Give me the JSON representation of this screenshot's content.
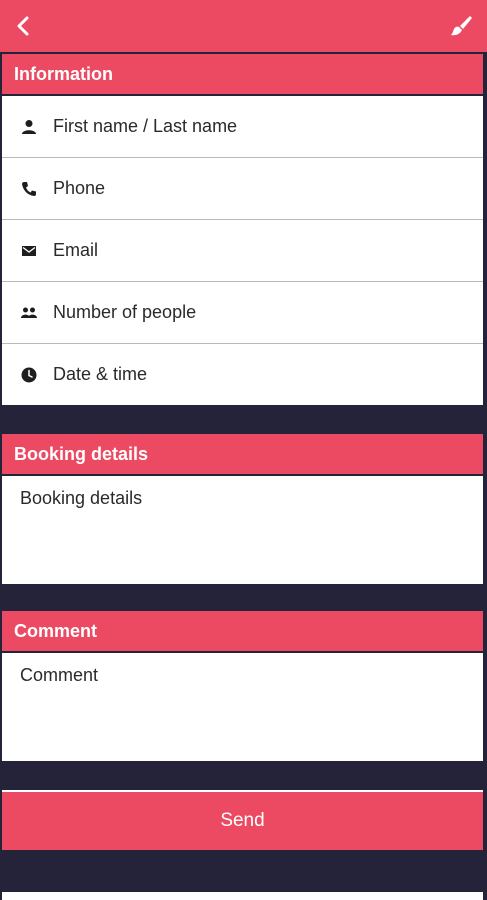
{
  "topbar": {
    "back_icon": "chevron-left-icon",
    "brush_icon": "paintbrush-icon"
  },
  "information": {
    "title": "Information",
    "fields": [
      {
        "label": "First name / Last name",
        "icon": "person-icon"
      },
      {
        "label": "Phone",
        "icon": "phone-icon"
      },
      {
        "label": "Email",
        "icon": "mail-icon"
      },
      {
        "label": "Number of people",
        "icon": "group-icon"
      },
      {
        "label": "Date & time",
        "icon": "clock-icon"
      }
    ]
  },
  "booking": {
    "title": "Booking details",
    "placeholder": "Booking details"
  },
  "comment": {
    "title": "Comment",
    "placeholder": "Comment"
  },
  "send_label": "Send",
  "colors": {
    "accent": "#ec4a62",
    "background": "#24233a",
    "surface": "#ffffff"
  }
}
